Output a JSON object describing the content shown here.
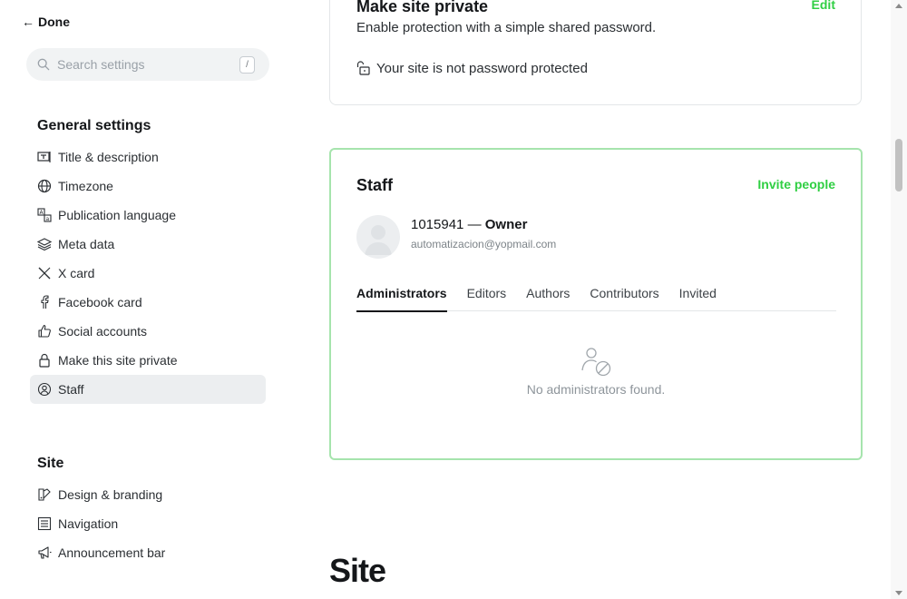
{
  "header": {
    "done_label": "Done"
  },
  "search": {
    "placeholder": "Search settings",
    "shortcut": "/"
  },
  "sidebar": {
    "general_title": "General settings",
    "general_items": [
      {
        "label": "Title & description",
        "icon": "title-icon"
      },
      {
        "label": "Timezone",
        "icon": "globe-icon"
      },
      {
        "label": "Publication language",
        "icon": "language-icon"
      },
      {
        "label": "Meta data",
        "icon": "layers-icon"
      },
      {
        "label": "X card",
        "icon": "x-logo-icon"
      },
      {
        "label": "Facebook card",
        "icon": "facebook-icon"
      },
      {
        "label": "Social accounts",
        "icon": "thumbs-up-icon"
      },
      {
        "label": "Make this site private",
        "icon": "lock-icon"
      },
      {
        "label": "Staff",
        "icon": "staff-icon",
        "active": true
      }
    ],
    "site_title": "Site",
    "site_items": [
      {
        "label": "Design & branding",
        "icon": "paint-icon"
      },
      {
        "label": "Navigation",
        "icon": "list-icon"
      },
      {
        "label": "Announcement bar",
        "icon": "megaphone-icon"
      }
    ]
  },
  "private_card": {
    "title": "Make site private",
    "edit_label": "Edit",
    "description": "Enable protection with a simple shared password.",
    "status": "Your site is not password protected"
  },
  "staff_card": {
    "title": "Staff",
    "invite_label": "Invite people",
    "owner_name": "1015941",
    "owner_separator": " — ",
    "owner_role": "Owner",
    "owner_email": "automatizacion@yopmail.com",
    "tabs": [
      "Administrators",
      "Editors",
      "Authors",
      "Contributors",
      "Invited"
    ],
    "active_tab": "Administrators",
    "empty_message": "No administrators found."
  },
  "main": {
    "site_heading": "Site"
  },
  "colors": {
    "accent_green": "#30cf43",
    "highlight_border": "#a6e4ad"
  }
}
